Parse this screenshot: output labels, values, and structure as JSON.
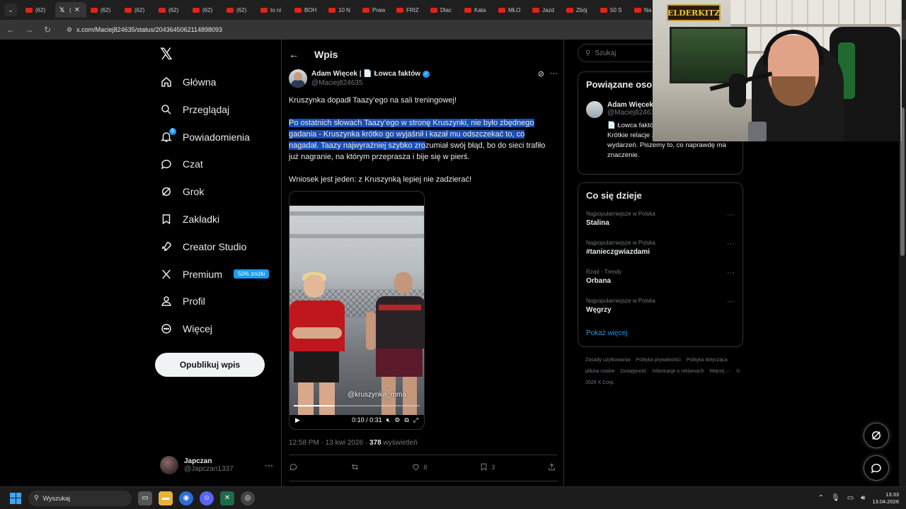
{
  "browser": {
    "tabs": [
      {
        "title": "(62)",
        "type": "youtube"
      },
      {
        "title": "(",
        "type": "x",
        "active": true
      },
      {
        "title": "(62)",
        "type": "youtube"
      },
      {
        "title": "(62)",
        "type": "youtube"
      },
      {
        "title": "(62)",
        "type": "youtube"
      },
      {
        "title": "(62)",
        "type": "youtube"
      },
      {
        "title": "(62)",
        "type": "youtube"
      },
      {
        "title": "to ni",
        "type": "youtube"
      },
      {
        "title": "BOH",
        "type": "youtube"
      },
      {
        "title": "10 N",
        "type": "youtube"
      },
      {
        "title": "Praw",
        "type": "youtube"
      },
      {
        "title": "FRIZ",
        "type": "youtube"
      },
      {
        "title": "Dlac",
        "type": "youtube"
      },
      {
        "title": "Kata",
        "type": "youtube"
      },
      {
        "title": "MŁO",
        "type": "youtube"
      },
      {
        "title": "Jazd",
        "type": "youtube"
      },
      {
        "title": "Zbój",
        "type": "youtube"
      },
      {
        "title": "50 S",
        "type": "youtube"
      },
      {
        "title": "Na",
        "type": "youtube"
      }
    ],
    "url": "x.com/Maciej824635/status/2043645062114898093"
  },
  "nav": {
    "items": [
      {
        "label": "Główna",
        "icon": "home-icon"
      },
      {
        "label": "Przeglądaj",
        "icon": "search-icon"
      },
      {
        "label": "Powiadomienia",
        "icon": "bell-icon",
        "badge": "5"
      },
      {
        "label": "Czat",
        "icon": "chat-icon"
      },
      {
        "label": "Grok",
        "icon": "grok-icon"
      },
      {
        "label": "Zakładki",
        "icon": "bookmark-icon"
      },
      {
        "label": "Creator Studio",
        "icon": "rocket-icon"
      },
      {
        "label": "Premium",
        "icon": "x-logo-icon",
        "promo": "50% zniżki"
      },
      {
        "label": "Profil",
        "icon": "person-icon"
      },
      {
        "label": "Więcej",
        "icon": "more-circle-icon"
      }
    ],
    "publish": "Opublikuj wpis",
    "account": {
      "name": "Japczan",
      "handle": "@Japczan1337"
    }
  },
  "post": {
    "header": "Wpis",
    "author_name": "Adam Więcek | 📄 Łowca faktów",
    "author_handle": "@Maciej824635",
    "paragraph1": "Kruszynka dopadł Taazy’ego na sali treningowej!",
    "paragraph2_highlighted": "Po ostatnich słowach Taazy’ego w stronę Kruszynki, nie było zbędnego gadania - Kruszynka krótko go wyjaśnił i kazał mu odszczekać to, co nagadał. Taazy najwyraźniej szybko zro",
    "paragraph2_rest": "zumiał swój błąd, bo do sieci trafiło już nagranie, na którym przeprasza i bije się w pierś.",
    "paragraph3": "Wniosek jest jeden: z Kruszynką lepiej nie zadzierać!",
    "video": {
      "watermark": "@kruszynka_mma",
      "time": "0:10 / 0:31",
      "progress": 0.32
    },
    "time": "12:58 PM · 13 kwi 2026 · ",
    "views": "378",
    "views_label": " wyświetleń",
    "likes": "8",
    "bookmarks": "3"
  },
  "right": {
    "search_placeholder": "Szukaj",
    "related_title": "Powiązane osoby",
    "related_user": {
      "name": "Adam Więcek",
      "handle": "@Maciej824635",
      "bio": "📄 Łowca faktów. Pokazujemy prawdy Krótkie relacje z najważniejszych wydarzeń. Piszemy to, co naprawdę ma znaczenie."
    },
    "trends_title": "Co się dzieje",
    "trends": [
      {
        "category": "Najpopularniejsze w Polska",
        "name": "Stalina"
      },
      {
        "category": "Najpopularniejsze w Polska",
        "name": "#tanieczgwiazdami"
      },
      {
        "category": "Rząd · Trendy",
        "name": "Orbana"
      },
      {
        "category": "Najpopularniejsze w Polska",
        "name": "Węgrzy"
      }
    ],
    "show_more": "Pokaż więcej",
    "footer": [
      "Zasady użytkowania",
      "Polityka prywatności",
      "Polityka dotycząca plików cookie",
      "Dostępność",
      "Informacje o reklamach",
      "Więcej ···",
      "© 2026 X Corp."
    ]
  },
  "webcam": {
    "sign": "ELDERKITZ"
  },
  "taskbar": {
    "search": "Wyszukaj",
    "time": "13:33",
    "date": "13.04.2026"
  }
}
